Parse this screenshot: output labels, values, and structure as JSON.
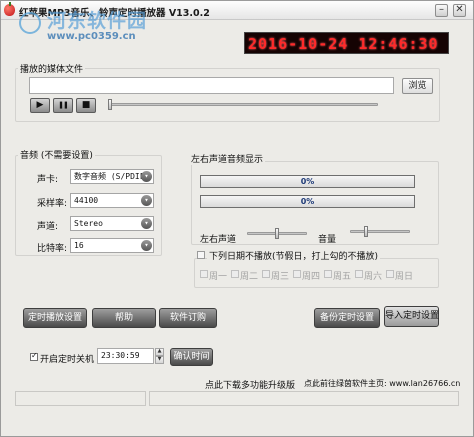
{
  "window": {
    "title": "红苹果MP3音乐、铃声定时播放器 V13.0.2",
    "minimize_glyph": "–",
    "close_glyph": "✕"
  },
  "watermark": {
    "name": "河东软件园",
    "url": "www.pc0359.cn"
  },
  "clock": {
    "display": "2016-10-24 12:46:30"
  },
  "file_section": {
    "title": "播放的媒体文件",
    "path": "",
    "browse_label": "浏览",
    "play_glyph": "▶",
    "pause_glyph": "❚❚",
    "stop_glyph": "■",
    "progress": 0
  },
  "audio_section": {
    "title": "音频 (不需要设置)",
    "sound_card_label": "声卡:",
    "sound_card_value": "数字音频 (S/PDIF)",
    "sample_rate_label": "采样率:",
    "sample_rate_value": "44100",
    "channel_label": "声道:",
    "channel_value": "Stereo",
    "bitrate_label": "比特率:",
    "bitrate_value": "16",
    "dropdown_glyph": "▾"
  },
  "meter_section": {
    "title": "左右声道音频显示",
    "left_level_text": "0%",
    "right_level_text": "0%",
    "left_level": 0,
    "right_level": 0,
    "balance_label": "左右声道",
    "balance": 0.5,
    "volume_label": "音量",
    "volume": 0.25
  },
  "date_section": {
    "title": "下列日期不播放(节假日，打上勾的不播放)",
    "checked": false,
    "days": [
      "周一",
      "周二",
      "周三",
      "周四",
      "周五",
      "周六",
      "周日"
    ]
  },
  "buttons": {
    "schedule": "定时播放设置",
    "help": "帮助",
    "order": "软件订购",
    "backup": "备份定时设置",
    "import": "导入定时设置",
    "confirm_time": "确认时间"
  },
  "shutdown": {
    "label": "开启定时关机",
    "checked": true,
    "time": "23:30:59"
  },
  "footer": {
    "upgrade_link": "点此下载多功能升级版",
    "site_link": "点此前往绿茵软件主页: www.lan26766.cn"
  },
  "colors": {
    "clock_digits": "#ff2a2a",
    "clock_bg": "#150303",
    "watermark": "#4f9bd7",
    "window_bg": "#ecebe7"
  }
}
